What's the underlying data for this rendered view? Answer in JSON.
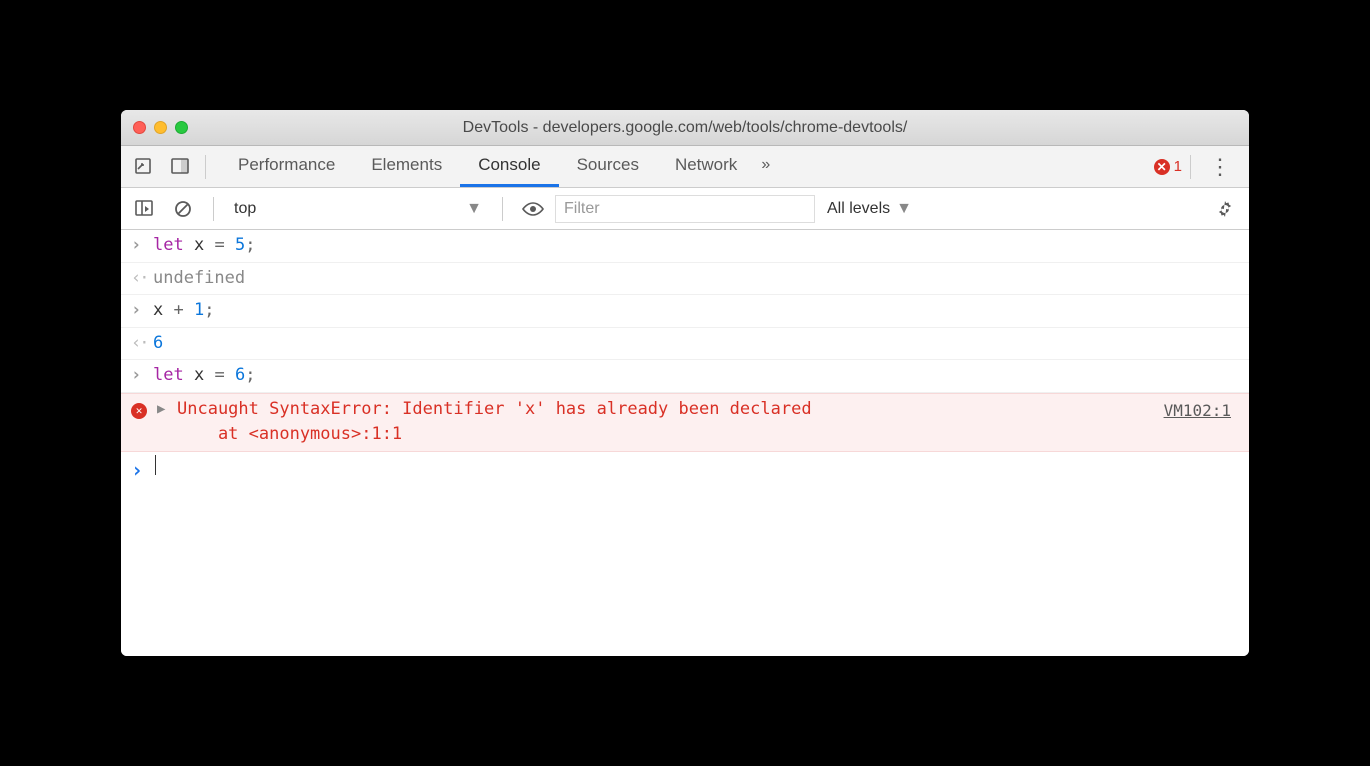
{
  "window": {
    "title": "DevTools - developers.google.com/web/tools/chrome-devtools/"
  },
  "tabs": {
    "items": [
      "Performance",
      "Elements",
      "Console",
      "Sources",
      "Network"
    ],
    "active": "Console",
    "more_glyph": "»"
  },
  "error_count": "1",
  "subtoolbar": {
    "context": "top",
    "filter_placeholder": "Filter",
    "levels_label": "All levels"
  },
  "console": {
    "rows": [
      {
        "type": "input",
        "tokens": [
          [
            "keyword",
            "let"
          ],
          [
            "space",
            " "
          ],
          [
            "ident",
            "x"
          ],
          [
            "space",
            " "
          ],
          [
            "op",
            "="
          ],
          [
            "space",
            " "
          ],
          [
            "num",
            "5"
          ],
          [
            "op",
            ";"
          ]
        ]
      },
      {
        "type": "output",
        "tokens": [
          [
            "undef",
            "undefined"
          ]
        ]
      },
      {
        "type": "input",
        "tokens": [
          [
            "ident",
            "x"
          ],
          [
            "space",
            " "
          ],
          [
            "op",
            "+"
          ],
          [
            "space",
            " "
          ],
          [
            "num",
            "1"
          ],
          [
            "op",
            ";"
          ]
        ]
      },
      {
        "type": "output",
        "tokens": [
          [
            "num",
            "6"
          ]
        ]
      },
      {
        "type": "input",
        "tokens": [
          [
            "keyword",
            "let"
          ],
          [
            "space",
            " "
          ],
          [
            "ident",
            "x"
          ],
          [
            "space",
            " "
          ],
          [
            "op",
            "="
          ],
          [
            "space",
            " "
          ],
          [
            "num",
            "6"
          ],
          [
            "op",
            ";"
          ]
        ]
      }
    ],
    "error": {
      "message": "Uncaught SyntaxError: Identifier 'x' has already been declared",
      "stack": "    at <anonymous>:1:1",
      "src": "VM102:1"
    }
  }
}
